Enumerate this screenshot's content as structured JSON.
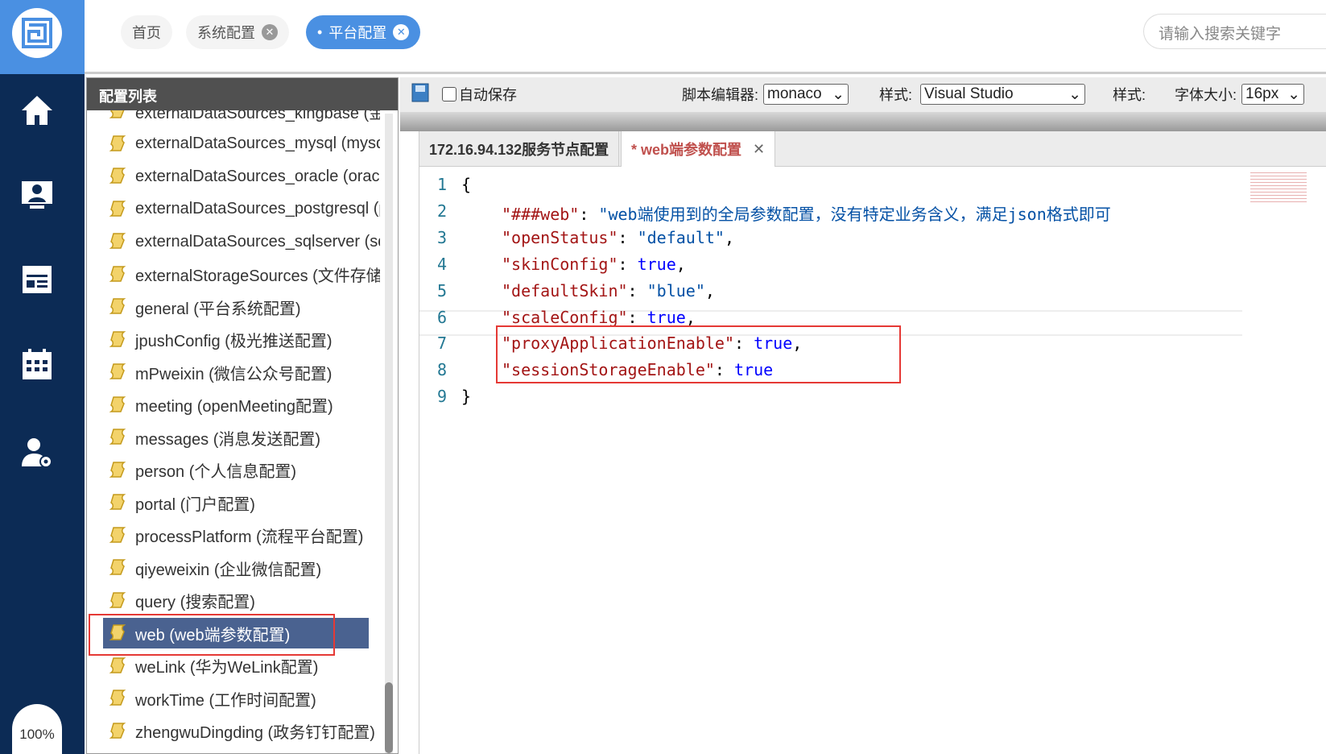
{
  "nav": {
    "zoom": "100%",
    "icons": [
      "home-icon",
      "monitor-user-icon",
      "report-icon",
      "calendar-icon",
      "user-settings-icon"
    ]
  },
  "tabs": [
    {
      "label": "首页"
    },
    {
      "label": "系统配置"
    },
    {
      "label": "平台配置",
      "active": true
    }
  ],
  "search": {
    "placeholder": "请输入搜索关键字"
  },
  "panel": {
    "title": "配置列表",
    "items": [
      "externalDataSources_kingbase (金",
      "externalDataSources_mysql (mysql",
      "externalDataSources_oracle (oracle",
      "externalDataSources_postgresql (p",
      "externalDataSources_sqlserver (sq",
      "externalStorageSources (文件存储",
      "general (平台系统配置)",
      "jpushConfig (极光推送配置)",
      "mPweixin (微信公众号配置)",
      "meeting (openMeeting配置)",
      "messages (消息发送配置)",
      "person (个人信息配置)",
      "portal (门户配置)",
      "processPlatform (流程平台配置)",
      "qiyeweixin (企业微信配置)",
      "query (搜索配置)",
      "web (web端参数配置)",
      "weLink (华为WeLink配置)",
      "workTime (工作时间配置)",
      "zhengwuDingding (政务钉钉配置)"
    ],
    "selected_index": 16
  },
  "toolbar": {
    "autosave": "自动保存",
    "editor_label": "脚本编辑器:",
    "editor_value": "monaco",
    "style_label": "样式:",
    "style_value": "Visual Studio",
    "style_label2": "样式:",
    "fontsize_label": "字体大小:",
    "fontsize_value": "16px"
  },
  "editor": {
    "tabs": [
      "172.16.94.132服务节点配置",
      "* web端参数配置"
    ],
    "lines": [
      [
        [
          "p",
          "{"
        ]
      ],
      [
        [
          "k",
          "\"###web\""
        ],
        [
          "p",
          ": "
        ],
        [
          "s",
          "\"web端使用到的全局参数配置，没有特定业务含义，满足json格式即可"
        ]
      ],
      [
        [
          "k",
          "\"openStatus\""
        ],
        [
          "p",
          ": "
        ],
        [
          "s",
          "\"default\""
        ],
        [
          "p",
          ","
        ]
      ],
      [
        [
          "k",
          "\"skinConfig\""
        ],
        [
          "p",
          ": "
        ],
        [
          "b",
          "true"
        ],
        [
          "p",
          ","
        ]
      ],
      [
        [
          "k",
          "\"defaultSkin\""
        ],
        [
          "p",
          ": "
        ],
        [
          "s",
          "\"blue\""
        ],
        [
          "p",
          ","
        ]
      ],
      [
        [
          "k",
          "\"scaleConfig\""
        ],
        [
          "p",
          ": "
        ],
        [
          "b",
          "true"
        ],
        [
          "p",
          ","
        ]
      ],
      [
        [
          "k",
          "\"proxyApplicationEnable\""
        ],
        [
          "p",
          ": "
        ],
        [
          "b",
          "true"
        ],
        [
          "p",
          ","
        ]
      ],
      [
        [
          "k",
          "\"sessionStorageEnable\""
        ],
        [
          "p",
          ": "
        ],
        [
          "b",
          "true"
        ]
      ],
      [
        [
          "p",
          "}"
        ]
      ]
    ]
  },
  "colors": {
    "nav": "#0c2b55",
    "accent": "#4a90e2",
    "selected": "#4a6290",
    "highlight": "#e53935"
  }
}
